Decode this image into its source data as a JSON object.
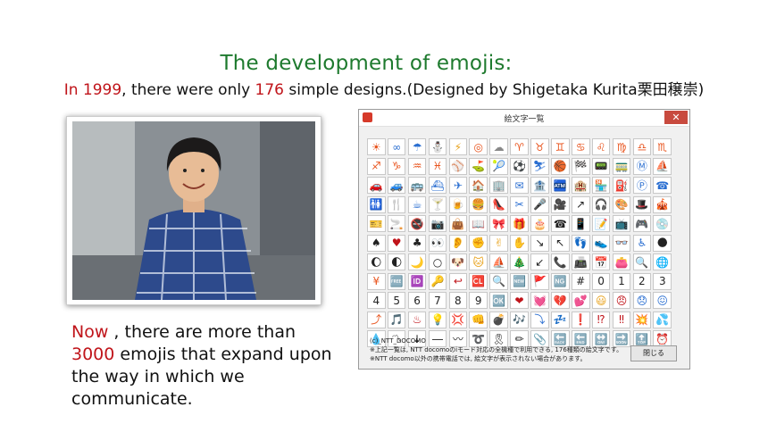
{
  "heading": {
    "title": "The development of emojis:",
    "year": "In 1999",
    "mid_text": ",  there were only ",
    "count": "176",
    "end_text": " simple designs.(Designed by Shigetaka Kurita栗田穣崇)"
  },
  "caption": {
    "now": "Now",
    "part1": " , there are more than ",
    "number": "3000",
    "part2": " emojis that expand upon the way in which we communicate."
  },
  "window": {
    "title": "絵文字一覧",
    "close_glyph": "✕",
    "footer_line1": "(c)_NTT_DOCOMO",
    "footer_line2": "※上記一覧は, NTT docomoのiモード対応の全機種で利用できる, 176種類の絵文字です。",
    "footer_line3": "※NTT docomo以外の携帯電話では, 絵文字が表示されない場合があります。",
    "close_button": "閉じる"
  },
  "emoji_grid": [
    {
      "g": "☀",
      "c": "#e8531c"
    },
    {
      "g": "∞",
      "c": "#2b6fd1"
    },
    {
      "g": "☂",
      "c": "#2b6fd1"
    },
    {
      "g": "⛄",
      "c": "#2b6fd1"
    },
    {
      "g": "⚡",
      "c": "#e8a21c"
    },
    {
      "g": "◎",
      "c": "#e8531c"
    },
    {
      "g": "☁",
      "c": "#888888"
    },
    {
      "g": "♈",
      "c": "#e8531c"
    },
    {
      "g": "♉",
      "c": "#e8531c"
    },
    {
      "g": "♊",
      "c": "#e8531c"
    },
    {
      "g": "♋",
      "c": "#e8531c"
    },
    {
      "g": "♌",
      "c": "#e8531c"
    },
    {
      "g": "♍",
      "c": "#e8531c"
    },
    {
      "g": "♎",
      "c": "#e8531c"
    },
    {
      "g": "♏",
      "c": "#e8531c"
    },
    {
      "g": "♐",
      "c": "#e8531c"
    },
    {
      "g": "♑",
      "c": "#e8531c"
    },
    {
      "g": "♒",
      "c": "#e8531c"
    },
    {
      "g": "♓",
      "c": "#e8531c"
    },
    {
      "g": "⚾",
      "c": "#2b6fd1"
    },
    {
      "g": "⛳",
      "c": "#2f9e3a"
    },
    {
      "g": "🎾",
      "c": "#2f9e3a"
    },
    {
      "g": "⚽",
      "c": "#222222"
    },
    {
      "g": "⛷",
      "c": "#2b6fd1"
    },
    {
      "g": "🏀",
      "c": "#e8531c"
    },
    {
      "g": "🏁",
      "c": "#222222"
    },
    {
      "g": "📟",
      "c": "#c0141a"
    },
    {
      "g": "🚃",
      "c": "#e8531c"
    },
    {
      "g": "Ⓜ",
      "c": "#2b6fd1"
    },
    {
      "g": "⛵",
      "c": "#2b6fd1"
    },
    {
      "g": "🚗",
      "c": "#2b6fd1"
    },
    {
      "g": "🚙",
      "c": "#2f9e3a"
    },
    {
      "g": "🚌",
      "c": "#e8531c"
    },
    {
      "g": "⛴",
      "c": "#2b6fd1"
    },
    {
      "g": "✈",
      "c": "#2b6fd1"
    },
    {
      "g": "🏠",
      "c": "#e8531c"
    },
    {
      "g": "🏢",
      "c": "#2b6fd1"
    },
    {
      "g": "✉",
      "c": "#2b6fd1"
    },
    {
      "g": "🏦",
      "c": "#c0141a"
    },
    {
      "g": "🏧",
      "c": "#c0141a"
    },
    {
      "g": "🏨",
      "c": "#e8531c"
    },
    {
      "g": "🏪",
      "c": "#2b6fd1"
    },
    {
      "g": "⛽",
      "c": "#2b6fd1"
    },
    {
      "g": "Ⓟ",
      "c": "#2b6fd1"
    },
    {
      "g": "☎",
      "c": "#2b6fd1"
    },
    {
      "g": "🚻",
      "c": "#222222"
    },
    {
      "g": "🍴",
      "c": "#222222"
    },
    {
      "g": "☕",
      "c": "#2b6fd1"
    },
    {
      "g": "🍸",
      "c": "#e23a8c"
    },
    {
      "g": "🍺",
      "c": "#e8a21c"
    },
    {
      "g": "🍔",
      "c": "#e8531c"
    },
    {
      "g": "👠",
      "c": "#c0141a"
    },
    {
      "g": "✂",
      "c": "#2b6fd1"
    },
    {
      "g": "🎤",
      "c": "#222222"
    },
    {
      "g": "🎥",
      "c": "#2b6fd1"
    },
    {
      "g": "↗",
      "c": "#222222"
    },
    {
      "g": "🎧",
      "c": "#e8531c"
    },
    {
      "g": "🎨",
      "c": "#2b6fd1"
    },
    {
      "g": "🎩",
      "c": "#222222"
    },
    {
      "g": "🎪",
      "c": "#e23a8c"
    },
    {
      "g": "🎫",
      "c": "#e8531c"
    },
    {
      "g": "🚬",
      "c": "#222222"
    },
    {
      "g": "🚭",
      "c": "#c0141a"
    },
    {
      "g": "📷",
      "c": "#222222"
    },
    {
      "g": "👜",
      "c": "#e8531c"
    },
    {
      "g": "📖",
      "c": "#e8531c"
    },
    {
      "g": "🎀",
      "c": "#c0141a"
    },
    {
      "g": "🎁",
      "c": "#c0141a"
    },
    {
      "g": "🎂",
      "c": "#c0141a"
    },
    {
      "g": "☎",
      "c": "#222222"
    },
    {
      "g": "📱",
      "c": "#2b6fd1"
    },
    {
      "g": "📝",
      "c": "#e8a21c"
    },
    {
      "g": "📺",
      "c": "#2b6fd1"
    },
    {
      "g": "🎮",
      "c": "#222222"
    },
    {
      "g": "💿",
      "c": "#2b6fd1"
    },
    {
      "g": "♠",
      "c": "#222222"
    },
    {
      "g": "♥",
      "c": "#c0141a"
    },
    {
      "g": "♣",
      "c": "#222222"
    },
    {
      "g": "👀",
      "c": "#222222"
    },
    {
      "g": "👂",
      "c": "#e8a21c"
    },
    {
      "g": "✊",
      "c": "#e8a21c"
    },
    {
      "g": "✌",
      "c": "#e8a21c"
    },
    {
      "g": "✋",
      "c": "#e8a21c"
    },
    {
      "g": "↘",
      "c": "#222222"
    },
    {
      "g": "↖",
      "c": "#222222"
    },
    {
      "g": "👣",
      "c": "#e8531c"
    },
    {
      "g": "👟",
      "c": "#222222"
    },
    {
      "g": "👓",
      "c": "#2b6fd1"
    },
    {
      "g": "♿",
      "c": "#2b6fd1"
    },
    {
      "g": "🌑",
      "c": "#222222"
    },
    {
      "g": "🌔",
      "c": "#222222"
    },
    {
      "g": "🌓",
      "c": "#222222"
    },
    {
      "g": "🌙",
      "c": "#e8a21c"
    },
    {
      "g": "○",
      "c": "#222222"
    },
    {
      "g": "🐶",
      "c": "#e8a21c"
    },
    {
      "g": "🐱",
      "c": "#e8a21c"
    },
    {
      "g": "⛵",
      "c": "#2b6fd1"
    },
    {
      "g": "🎄",
      "c": "#2f9e3a"
    },
    {
      "g": "↙",
      "c": "#222222"
    },
    {
      "g": "📞",
      "c": "#2b6fd1"
    },
    {
      "g": "📠",
      "c": "#222222"
    },
    {
      "g": "📅",
      "c": "#e8531c"
    },
    {
      "g": "👛",
      "c": "#e23a8c"
    },
    {
      "g": "🔍",
      "c": "#222222"
    },
    {
      "g": "🌐",
      "c": "#222222"
    },
    {
      "g": "¥",
      "c": "#e8531c"
    },
    {
      "g": "🆓",
      "c": "#e8531c"
    },
    {
      "g": "🆔",
      "c": "#c0141a"
    },
    {
      "g": "🔑",
      "c": "#c0141a"
    },
    {
      "g": "↩",
      "c": "#c0141a"
    },
    {
      "g": "🆑",
      "c": "#222222"
    },
    {
      "g": "🔍",
      "c": "#2b6fd1"
    },
    {
      "g": "🆕",
      "c": "#e8531c"
    },
    {
      "g": "🚩",
      "c": "#e8531c"
    },
    {
      "g": "🆖",
      "c": "#222222"
    },
    {
      "g": "#",
      "c": "#222222"
    },
    {
      "g": "0",
      "c": "#222222"
    },
    {
      "g": "1",
      "c": "#222222"
    },
    {
      "g": "2",
      "c": "#222222"
    },
    {
      "g": "3",
      "c": "#222222"
    },
    {
      "g": "4",
      "c": "#222222"
    },
    {
      "g": "5",
      "c": "#222222"
    },
    {
      "g": "6",
      "c": "#222222"
    },
    {
      "g": "7",
      "c": "#222222"
    },
    {
      "g": "8",
      "c": "#222222"
    },
    {
      "g": "9",
      "c": "#222222"
    },
    {
      "g": "🆗",
      "c": "#c0141a"
    },
    {
      "g": "❤",
      "c": "#c0141a"
    },
    {
      "g": "💓",
      "c": "#c0141a"
    },
    {
      "g": "💔",
      "c": "#c0141a"
    },
    {
      "g": "💕",
      "c": "#c0141a"
    },
    {
      "g": "😃",
      "c": "#e8a21c"
    },
    {
      "g": "😠",
      "c": "#c0141a"
    },
    {
      "g": "😞",
      "c": "#2b6fd1"
    },
    {
      "g": "😖",
      "c": "#2b6fd1"
    },
    {
      "g": "⤴",
      "c": "#e8531c"
    },
    {
      "g": "🎵",
      "c": "#e8531c"
    },
    {
      "g": "♨",
      "c": "#c0141a"
    },
    {
      "g": "💡",
      "c": "#e8a21c"
    },
    {
      "g": "💢",
      "c": "#c0141a"
    },
    {
      "g": "👊",
      "c": "#e8a21c"
    },
    {
      "g": "💣",
      "c": "#222222"
    },
    {
      "g": "🎶",
      "c": "#e8531c"
    },
    {
      "g": "⤵",
      "c": "#2b6fd1"
    },
    {
      "g": "💤",
      "c": "#2b6fd1"
    },
    {
      "g": "❗",
      "c": "#c0141a"
    },
    {
      "g": "⁉",
      "c": "#c0141a"
    },
    {
      "g": "‼",
      "c": "#c0141a"
    },
    {
      "g": "💥",
      "c": "#e8531c"
    },
    {
      "g": "💦",
      "c": "#2b6fd1"
    },
    {
      "g": "💧",
      "c": "#2b6fd1"
    },
    {
      "g": "〽",
      "c": "#222222"
    },
    {
      "g": "↓",
      "c": "#222222"
    },
    {
      "g": "―",
      "c": "#222222"
    },
    {
      "g": "〰",
      "c": "#222222"
    },
    {
      "g": "➰",
      "c": "#222222"
    },
    {
      "g": "🎗",
      "c": "#222222"
    },
    {
      "g": "✏",
      "c": "#222222"
    },
    {
      "g": "📎",
      "c": "#222222"
    },
    {
      "g": "🔙",
      "c": "#222222"
    },
    {
      "g": "🔚",
      "c": "#222222"
    },
    {
      "g": "🔛",
      "c": "#222222"
    },
    {
      "g": "🔜",
      "c": "#222222"
    },
    {
      "g": "🔝",
      "c": "#222222"
    },
    {
      "g": "⏰",
      "c": "#222222"
    }
  ]
}
